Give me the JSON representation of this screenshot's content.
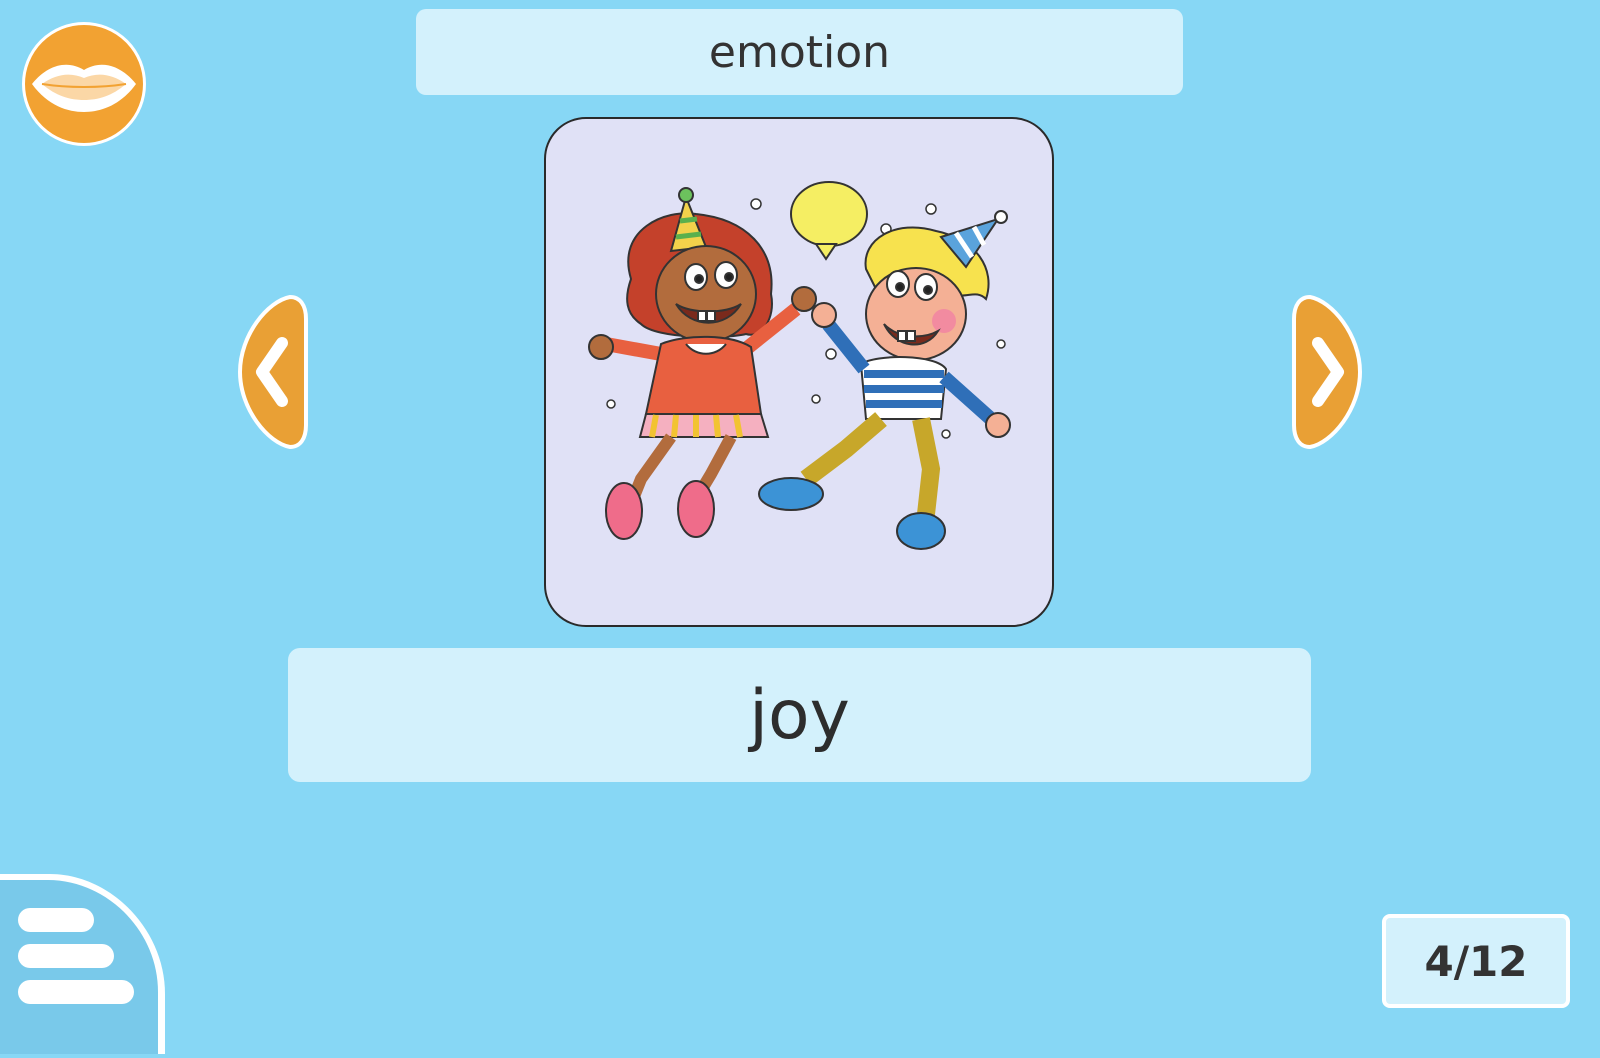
{
  "category": "emotion",
  "word": "joy",
  "counter": "4/12",
  "icons": {
    "speak": "lips-icon",
    "prev": "chevron-left-icon",
    "next": "chevron-right-icon",
    "menu": "hamburger-menu-icon"
  },
  "colors": {
    "background": "#87d7f5",
    "panel": "#d3f1fc",
    "card": "#e0e1f6",
    "accent_orange": "#f2a232",
    "text": "#333333"
  }
}
